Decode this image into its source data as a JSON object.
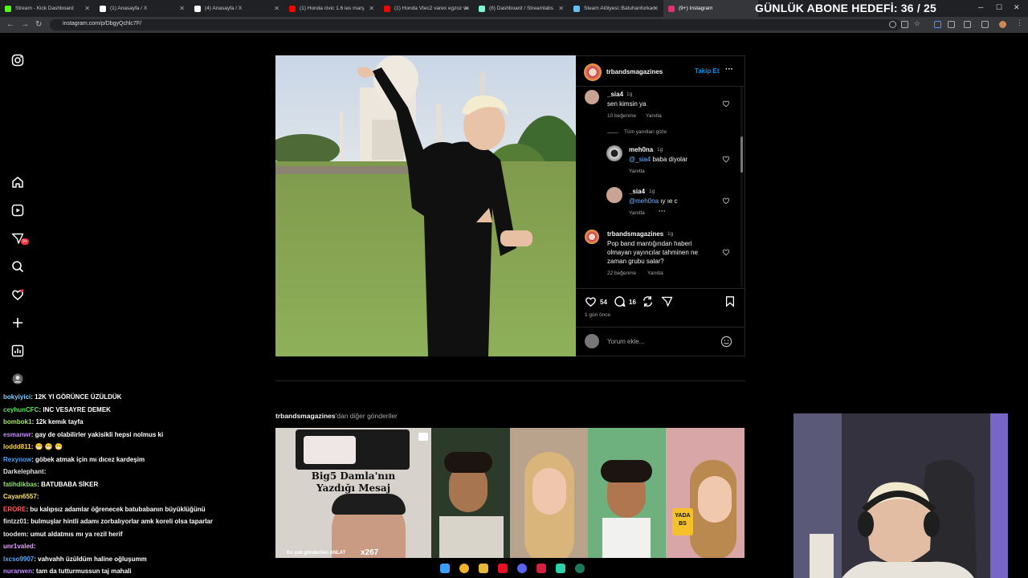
{
  "browser": {
    "tabs": [
      {
        "label": "Stream - Kick Dashboard",
        "color": "#53fc18"
      },
      {
        "label": "(1) Anasayfa / X",
        "color": "#ffffff"
      },
      {
        "label": "(4) Anasayfa / X",
        "color": "#ffffff"
      },
      {
        "label": "(1) Honda civic 1.6 ies marş",
        "color": "#ff0000"
      },
      {
        "label": "(1) Honda Vtec2 varex egzoz ve",
        "color": "#ff0000"
      },
      {
        "label": "(8) Dashboard / Streamlabs",
        "color": "#80f5d2"
      },
      {
        "label": "Steam Atölyesi::Batuhanfurkan",
        "color": "#66c0f4"
      },
      {
        "label": "(9+) Instagram",
        "color": "#e1306c"
      }
    ],
    "url": "instagram.com/p/DbgyQchlc7F/"
  },
  "overlay": {
    "abone_hedefi": "GÜNLÜK ABONE HEDEFİ: 36 / 25"
  },
  "rail": {
    "notification_badge": "9+"
  },
  "post": {
    "author": "trbandsmagazines",
    "follow_label": "Takip Et",
    "more_label": "···",
    "comments": [
      {
        "user": "_sia4",
        "time": "1g",
        "text": "sen kimsin ya",
        "likes": "10 beğenme",
        "reply": "Yanıtla"
      },
      {
        "hide_replies": "Tüm yanıtları gizle"
      },
      {
        "user": "meh0na",
        "time": "1g",
        "mention": "@_sia4",
        "text": "baba diyolar",
        "reply": "Yanıtla"
      },
      {
        "user": "_sia4",
        "time": "1g",
        "mention": "@meh0na",
        "text": "ıy ıe c",
        "reply": "Yanıtla",
        "dots": "···"
      },
      {
        "user": "trbandsmagazines",
        "time": "1g",
        "text": "Pop band mantığından haberi olmayan yayıncılar tahminen ne zaman grubu salar?",
        "likes": "22 beğenme",
        "reply": "Yanıtla"
      }
    ],
    "like_count": "54",
    "comment_count": "16",
    "posted": "1 gün önce",
    "add_comment_placeholder": "Yorum ekle..."
  },
  "more_posts": {
    "heading_user": "trbandsmagazines",
    "heading_suffix": "'dan diğer gönderiler",
    "thumb1_title": "Big5 Damla'nın Yazdığı Mesaj",
    "thumb1_caption": "En çok gönderilen ANLAT",
    "thumb1_count": "x267",
    "thumb5_badge": "YADA BS"
  },
  "chat": [
    {
      "user": "bokyiyici",
      "color": "#7fd0ff",
      "text": ": 12K YI GÖRÜNCE ÜZÜLDÜK"
    },
    {
      "user": "ceyhunCFC",
      "color": "#5ce65c",
      "text": ": INC VESAYRE DEMEK"
    },
    {
      "user": "bombok1",
      "color": "#9fe86a",
      "text": ": 12k kemık tayfa"
    },
    {
      "user": "esmanwr",
      "color": "#c58bff",
      "text": ": gay de olabilirler yakisikli hepsi nolmus ki"
    },
    {
      "user": "loddd811",
      "color": "#ffd54a",
      "text": ": 😁 😁 😁"
    },
    {
      "user": "Rexynow",
      "color": "#4aa3ff",
      "text": ": göbek atmak için mı dıcez kardeşim"
    },
    {
      "user": "Darkelephant",
      "color": "#e0e0e0",
      "text": ":"
    },
    {
      "user": "fatihdikbas",
      "color": "#8ee07a",
      "text": ": BATUBABA SİKER"
    },
    {
      "user": "Cayan6557",
      "color": "#ffe066",
      "text": ":"
    },
    {
      "user": "ERORE",
      "color": "#ff5a5a",
      "text": ": bu kalıpsız adamlar öğrenecek batubabanın büyüklüğünü"
    },
    {
      "user": "fintzz01",
      "color": "#e8e8e8",
      "text": ": bulmuşlar hintli adamı zorbalıyorlar amk koreli olsa taparlar"
    },
    {
      "user": "toodem",
      "color": "#e8e8e8",
      "text": ": umut aldatmıs mı ya rezil herif"
    },
    {
      "user": "unr1valed",
      "color": "#e8a0ff",
      "text": ":"
    },
    {
      "user": "lxcso9907",
      "color": "#5aa8ff",
      "text": ": vahvahh üzüldüm haline oğluşumm"
    },
    {
      "user": "nurarwen",
      "color": "#c58bff",
      "text": ": tam da tutturmussun taj mahali"
    }
  ]
}
